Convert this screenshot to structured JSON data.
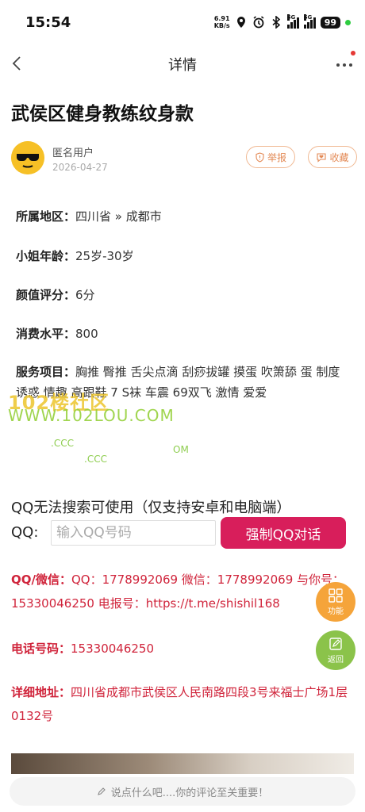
{
  "status_bar": {
    "time": "15:54",
    "net_speed_value": "6.91",
    "net_speed_unit": "KB/s",
    "signal_1": "5G",
    "signal_2": "5G",
    "battery": "99"
  },
  "nav": {
    "title": "详情"
  },
  "post": {
    "title": "武侯区健身教练纹身款",
    "author": "匿名用户",
    "date": "2026-04-27",
    "report_label": "举报",
    "favorite_label": "收藏"
  },
  "details": [
    {
      "label": "所属地区：",
      "value": "四川省 » 成都市"
    },
    {
      "label": "小姐年龄：",
      "value": "25岁-30岁"
    },
    {
      "label": "颜值评分：",
      "value": "6分"
    },
    {
      "label": "消费水平：",
      "value": "800"
    }
  ],
  "services": {
    "label": "服务项目：",
    "value": "胸推 臀推 舌尖点滴 刮痧拔罐 摸蛋 吹箫舔 蛋 制度诱惑 情趣 高跟鞋 7 S袜 车震 69双飞 激情 爱爱"
  },
  "watermark": {
    "line1": "102楼社区",
    "line2": "WWW.102LOU.COM",
    "frag1": ".CCC",
    "frag2": ".CCC",
    "frag3": "OM"
  },
  "qq_section": {
    "notice": "QQ无法搜索可使用（仅支持安卓和电脑端）",
    "label": "QQ:",
    "placeholder": "输入QQ号码",
    "button_label": "强制QQ对话"
  },
  "contacts": [
    {
      "label": "QQ/微信：",
      "value": "QQ：1778992069 微信：1778992069 与你号：15330046250 电报号：https://t.me/shishil168"
    },
    {
      "label": "电话号码：",
      "value": "15330046250"
    },
    {
      "label": "详细地址：",
      "value": "四川省成都市武侯区人民南路四段3号来福士广场1层0132号"
    }
  ],
  "fab": {
    "function_label": "功能",
    "back_label": "返回"
  },
  "comment": {
    "placeholder": "说点什么吧....你的评论至关重要！"
  },
  "colors": {
    "accent_red": "#d81e5b",
    "contact_red": "#d0243b",
    "pill_orange": "#e38a56",
    "fab_orange": "#f5a43a",
    "fab_green": "#8bc34a",
    "avatar_yellow": "#f6c026"
  },
  "icons": [
    "back-icon",
    "more-icon",
    "location-icon",
    "alarm-icon",
    "bluetooth-icon",
    "shield-icon",
    "heart-chat-icon",
    "grid-icon",
    "edit-icon",
    "pencil-icon",
    "sunglasses-avatar"
  ]
}
